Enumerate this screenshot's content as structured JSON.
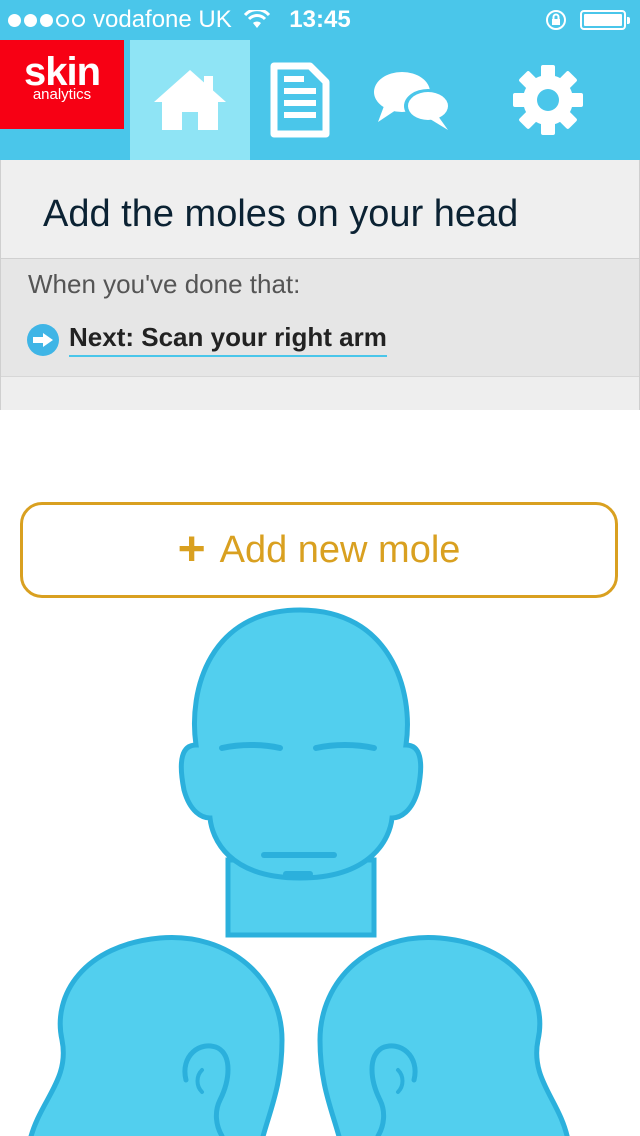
{
  "status_bar": {
    "carrier": "vodafone UK",
    "time": "13:45"
  },
  "logo": {
    "line1": "skin",
    "line2": "analytics"
  },
  "nav": {
    "tabs": [
      "home-icon",
      "document-icon",
      "chat-icon",
      "settings-icon"
    ],
    "active_tab": "home-icon"
  },
  "banner": {
    "title": "Add the moles on your head",
    "subtitle": "When you've done that:",
    "next_link": "Next: Scan your right arm"
  },
  "add_button": {
    "plus": "+",
    "label": "Add new mole"
  },
  "colors": {
    "brand_blue": "#4ac6ea",
    "active_tab": "#8fe4f5",
    "logo_red": "#f70014",
    "accent_gold": "#d9a020",
    "figure_fill": "#52cfee",
    "figure_stroke": "#2bb0dc"
  }
}
